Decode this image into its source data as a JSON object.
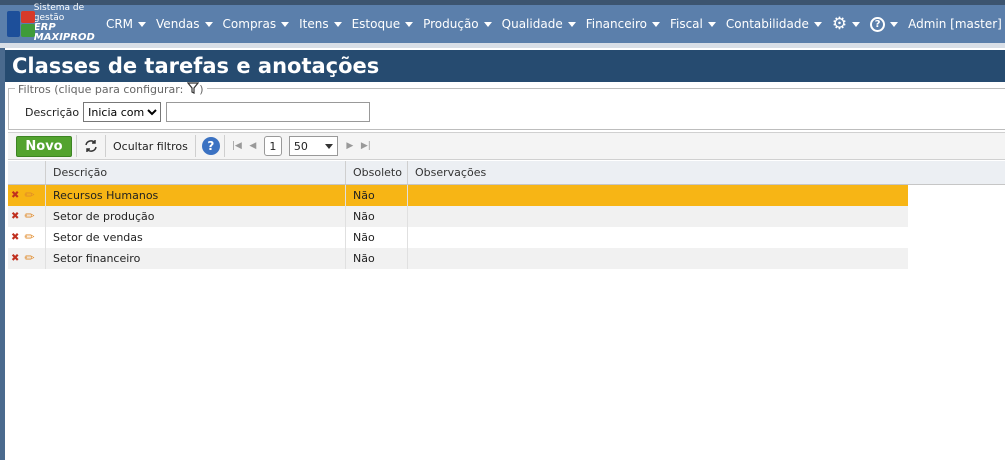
{
  "brand": {
    "line1": "Sistema de gestão",
    "line2": "ERP MAXIPROD"
  },
  "nav": {
    "items": [
      {
        "label": "CRM"
      },
      {
        "label": "Vendas"
      },
      {
        "label": "Compras"
      },
      {
        "label": "Itens"
      },
      {
        "label": "Estoque"
      },
      {
        "label": "Produção"
      },
      {
        "label": "Qualidade"
      },
      {
        "label": "Financeiro"
      },
      {
        "label": "Fiscal"
      },
      {
        "label": "Contabilidade"
      }
    ],
    "settings_icon": "gear-icon",
    "help_icon": "help-circle-icon",
    "user": "Admin [master]"
  },
  "page": {
    "title": "Classes de tarefas e anotações"
  },
  "filters": {
    "legend": "Filtros (clique para configurar:",
    "legend_close": ")",
    "field_label": "Descrição",
    "operator": "Inicia com",
    "operator_options": [
      "Inicia com"
    ],
    "value": ""
  },
  "toolbar": {
    "new_label": "Novo",
    "hide_filters_label": "Ocultar filtros",
    "help_label": "?",
    "page": "1",
    "page_size": "50"
  },
  "grid": {
    "columns": [
      "Descrição",
      "Obsoleto",
      "Observações"
    ],
    "rows": [
      {
        "descricao": "Recursos Humanos",
        "obsoleto": "Não",
        "observacoes": ""
      },
      {
        "descricao": "Setor de produção",
        "obsoleto": "Não",
        "observacoes": ""
      },
      {
        "descricao": "Setor de vendas",
        "obsoleto": "Não",
        "observacoes": ""
      },
      {
        "descricao": "Setor financeiro",
        "obsoleto": "Não",
        "observacoes": ""
      }
    ]
  },
  "colors": {
    "nav": "#5b7fab",
    "title_bar": "#264b70",
    "selected_row": "#f7b515",
    "new_button": "#53a32f"
  }
}
